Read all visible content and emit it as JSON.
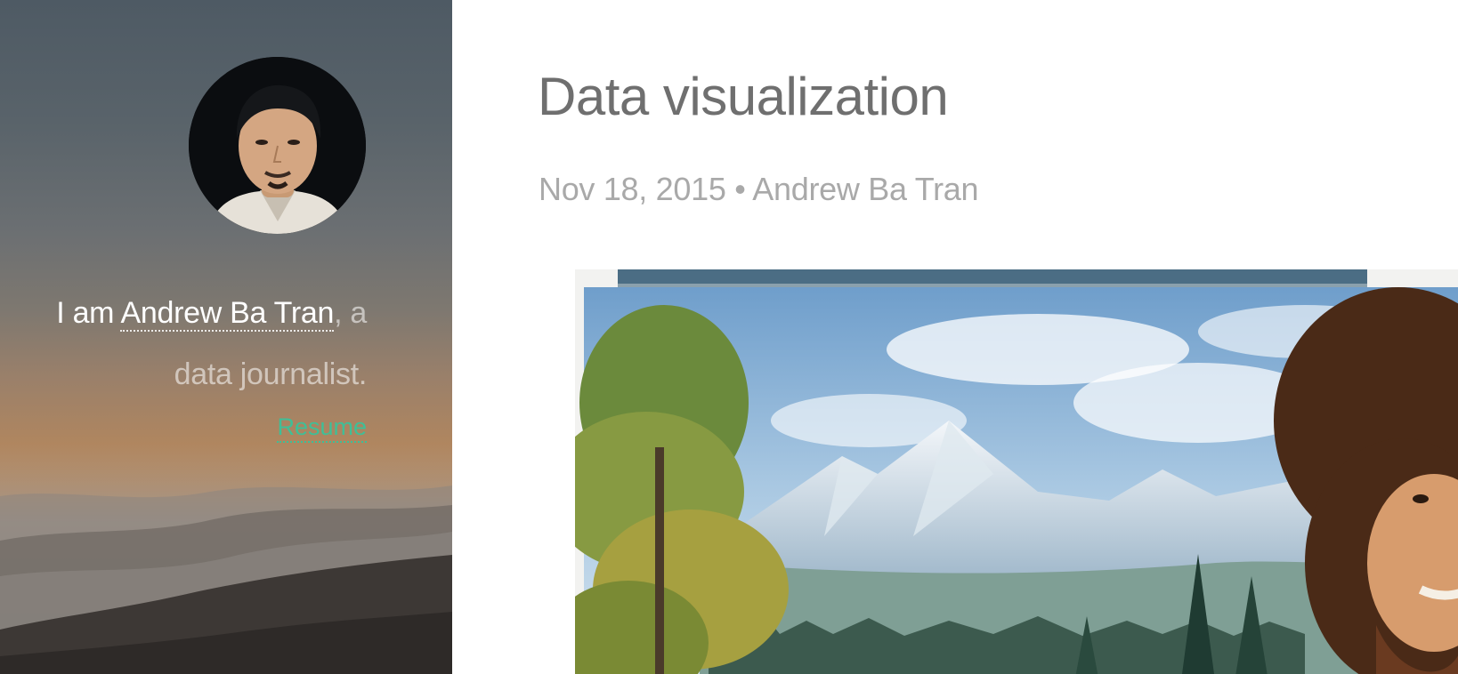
{
  "sidebar": {
    "avatar_label": "Andrew Ba Tran",
    "bio": {
      "prefix": "I am ",
      "name": "Andrew Ba Tran",
      "suffix": ", a data journalist."
    },
    "resume_label": "Resume"
  },
  "post": {
    "title": "Data visualization",
    "date": "Nov 18, 2015",
    "separator": "•",
    "author": "Andrew Ba Tran",
    "image_description": "painting-of-mountain-landscape-with-painter"
  },
  "colors": {
    "accent": "#3fbf97",
    "title_text": "#6f6f6f",
    "meta_text": "#a9a9a9",
    "sidebar_text": "#ffffff"
  }
}
